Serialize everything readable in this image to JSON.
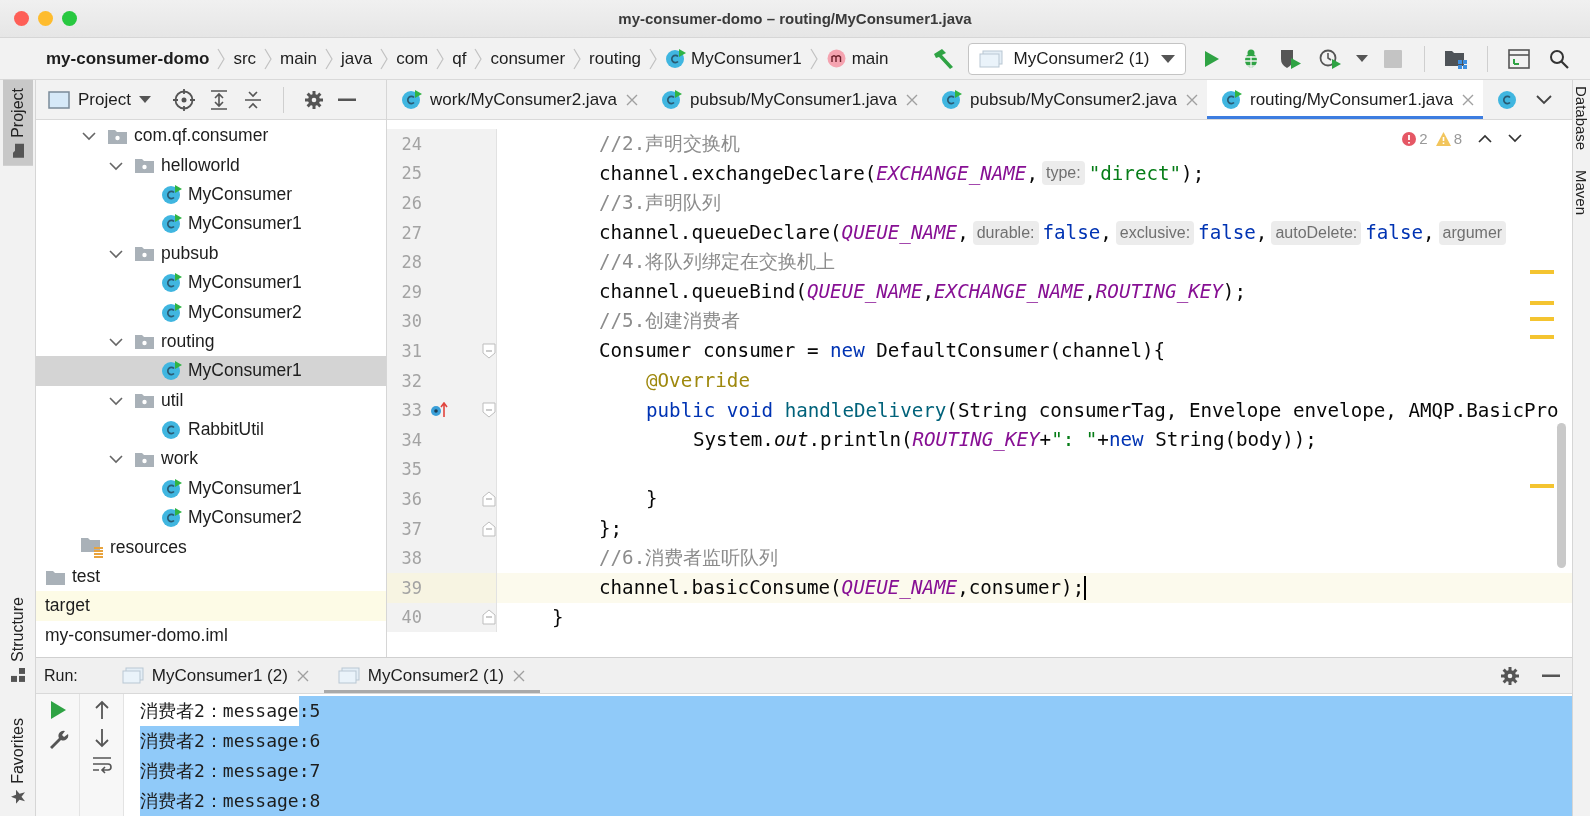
{
  "window": {
    "title": "my-consumer-domo – routing/MyConsumer1.java"
  },
  "breadcrumbs": [
    {
      "label": "my-consumer-domo",
      "kind": "project"
    },
    {
      "label": "src",
      "kind": "folder"
    },
    {
      "label": "main",
      "kind": "folder"
    },
    {
      "label": "java",
      "kind": "folder"
    },
    {
      "label": "com",
      "kind": "folder"
    },
    {
      "label": "qf",
      "kind": "folder"
    },
    {
      "label": "consumer",
      "kind": "folder"
    },
    {
      "label": "routing",
      "kind": "folder"
    },
    {
      "label": "MyConsumer1",
      "kind": "class"
    },
    {
      "label": "main",
      "kind": "method"
    }
  ],
  "run_config": {
    "label": "MyConsumer2 (1)"
  },
  "toolbar": [
    {
      "kind": "run",
      "disabled": false
    },
    {
      "kind": "debug",
      "disabled": false
    },
    {
      "kind": "coverage",
      "disabled": false
    },
    {
      "kind": "profile",
      "disabled": false
    },
    {
      "kind": "stop",
      "disabled": true
    },
    {
      "kind": "structure",
      "disabled": false
    },
    {
      "kind": "window",
      "disabled": false
    },
    {
      "kind": "search",
      "disabled": false
    }
  ],
  "left_strip": [
    {
      "label": "Project",
      "selected": true
    },
    {
      "label": "Structure",
      "selected": false
    },
    {
      "label": "Favorites",
      "selected": false
    }
  ],
  "right_strip": [
    {
      "label": "Database"
    },
    {
      "label": "Maven"
    }
  ],
  "project_panel": {
    "title": "Project",
    "tree": [
      {
        "label": "com.qf.consumer",
        "kind": "package",
        "expanded": true,
        "selected": false,
        "children": [
          {
            "label": "helloworld",
            "kind": "package",
            "expanded": true,
            "selected": false,
            "children": [
              {
                "label": "MyConsumer",
                "kind": "runnable",
                "selected": false
              },
              {
                "label": "MyConsumer1",
                "kind": "runnable",
                "selected": false
              }
            ]
          },
          {
            "label": "pubsub",
            "kind": "package",
            "expanded": true,
            "selected": false,
            "children": [
              {
                "label": "MyConsumer1",
                "kind": "runnable",
                "selected": false
              },
              {
                "label": "MyConsumer2",
                "kind": "runnable",
                "selected": false
              }
            ]
          },
          {
            "label": "routing",
            "kind": "package",
            "expanded": true,
            "selected": false,
            "children": [
              {
                "label": "MyConsumer1",
                "kind": "runnable",
                "selected": true
              }
            ]
          },
          {
            "label": "util",
            "kind": "package",
            "expanded": true,
            "selected": false,
            "children": [
              {
                "label": "RabbitUtil",
                "kind": "class",
                "selected": false
              }
            ]
          },
          {
            "label": "work",
            "kind": "package",
            "expanded": true,
            "selected": false,
            "children": [
              {
                "label": "MyConsumer1",
                "kind": "runnable",
                "selected": false
              },
              {
                "label": "MyConsumer2",
                "kind": "runnable",
                "selected": false
              }
            ]
          }
        ]
      },
      {
        "label": "resources",
        "kind": "resources",
        "selected": false
      },
      {
        "label": "test",
        "kind": "folder",
        "selected": false
      },
      {
        "label": "target",
        "kind": "excluded",
        "selected": false
      },
      {
        "label": "my-consumer-domo.iml",
        "kind": "file",
        "selected": false
      }
    ]
  },
  "editor": {
    "tabs": [
      {
        "label": "work/MyConsumer2.java",
        "selected": false
      },
      {
        "label": "pubsub/MyConsumer1.java",
        "selected": false
      },
      {
        "label": "pubsub/MyConsumer2.java",
        "selected": false
      },
      {
        "label": "routing/MyConsumer1.java",
        "selected": true
      }
    ],
    "errors": "2",
    "warnings": "8",
    "lines": [
      {
        "number": "24",
        "kind": "code",
        "current": false,
        "override": false,
        "foldable": false,
        "tokens": [
          {
            "kind": "comment",
            "text": "//2.声明交换机"
          }
        ]
      },
      {
        "number": "25",
        "kind": "code",
        "current": false,
        "override": false,
        "foldable": false,
        "tokens": [
          {
            "kind": "plain",
            "text": "channel.exchangeDeclare("
          },
          {
            "kind": "constant",
            "text": "EXCHANGE_NAME"
          },
          {
            "kind": "plain",
            "text": ","
          },
          {
            "kind": "hint",
            "text": "type:"
          },
          {
            "kind": "string",
            "text": "\"direct\""
          },
          {
            "kind": "plain",
            "text": ");"
          }
        ]
      },
      {
        "number": "26",
        "kind": "code",
        "current": false,
        "override": false,
        "foldable": false,
        "tokens": [
          {
            "kind": "comment",
            "text": "//3.声明队列"
          }
        ]
      },
      {
        "number": "27",
        "kind": "code",
        "current": false,
        "override": false,
        "foldable": false,
        "tokens": [
          {
            "kind": "plain",
            "text": "channel.queueDeclare("
          },
          {
            "kind": "constant",
            "text": "QUEUE_NAME"
          },
          {
            "kind": "plain",
            "text": ","
          },
          {
            "kind": "hint",
            "text": "durable:"
          },
          {
            "kind": "keyword",
            "text": "false"
          },
          {
            "kind": "plain",
            "text": ","
          },
          {
            "kind": "hint",
            "text": "exclusive:"
          },
          {
            "kind": "keyword",
            "text": "false"
          },
          {
            "kind": "plain",
            "text": ","
          },
          {
            "kind": "hint",
            "text": "autoDelete:"
          },
          {
            "kind": "keyword",
            "text": "false"
          },
          {
            "kind": "plain",
            "text": ","
          },
          {
            "kind": "hint",
            "text": "argumer"
          }
        ]
      },
      {
        "number": "28",
        "kind": "code",
        "current": false,
        "override": false,
        "foldable": false,
        "tokens": [
          {
            "kind": "comment",
            "text": "//4.将队列绑定在交换机上"
          }
        ]
      },
      {
        "number": "29",
        "kind": "code",
        "current": false,
        "override": false,
        "foldable": false,
        "tokens": [
          {
            "kind": "plain",
            "text": "channel.queueBind("
          },
          {
            "kind": "constant",
            "text": "QUEUE_NAME"
          },
          {
            "kind": "plain",
            "text": ","
          },
          {
            "kind": "constant",
            "text": "EXCHANGE_NAME"
          },
          {
            "kind": "plain",
            "text": ","
          },
          {
            "kind": "constant",
            "text": "ROUTING_KEY"
          },
          {
            "kind": "plain",
            "text": ");"
          }
        ]
      },
      {
        "number": "30",
        "kind": "code",
        "current": false,
        "override": false,
        "foldable": false,
        "tokens": [
          {
            "kind": "comment",
            "text": "//5.创建消费者"
          }
        ]
      },
      {
        "number": "31",
        "kind": "code",
        "current": false,
        "override": false,
        "foldable": true,
        "tokens": [
          {
            "kind": "plain",
            "text": "Consumer consumer = "
          },
          {
            "kind": "keyword",
            "text": "new"
          },
          {
            "kind": "plain",
            "text": " DefaultConsumer(channel){"
          }
        ],
        "children": [
          {
            "number": "32",
            "kind": "code",
            "current": false,
            "override": false,
            "foldable": false,
            "tokens": [
              {
                "kind": "annotation",
                "text": "@Override"
              }
            ]
          },
          {
            "number": "33",
            "kind": "code",
            "current": false,
            "override": true,
            "foldable": true,
            "tokens": [
              {
                "kind": "keyword",
                "text": "public void"
              },
              {
                "kind": "method",
                "text": " handleDelivery"
              },
              {
                "kind": "plain",
                "text": "(String consumerTag, Envelope envelope, AMQP.BasicPro"
              }
            ],
            "children": [
              {
                "number": "34",
                "kind": "code",
                "current": false,
                "override": false,
                "foldable": false,
                "tokens": [
                  {
                    "kind": "plain",
                    "text": "System."
                  },
                  {
                    "kind": "static",
                    "text": "out"
                  },
                  {
                    "kind": "plain",
                    "text": ".println("
                  },
                  {
                    "kind": "constant",
                    "text": "ROUTING_KEY"
                  },
                  {
                    "kind": "plain",
                    "text": "+"
                  },
                  {
                    "kind": "string",
                    "text": "\": \""
                  },
                  {
                    "kind": "plain",
                    "text": "+"
                  },
                  {
                    "kind": "keyword",
                    "text": "new"
                  },
                  {
                    "kind": "plain",
                    "text": " String(body));"
                  }
                ]
              },
              {
                "number": "35",
                "kind": "code",
                "current": false,
                "override": false,
                "foldable": false
              },
              {
                "number": "36",
                "kind": "closing",
                "current": false,
                "override": false,
                "foldable": true,
                "tokens": [
                  {
                    "kind": "plain",
                    "text": "}"
                  }
                ]
              }
            ]
          },
          {
            "number": "37",
            "kind": "closing",
            "current": false,
            "override": false,
            "foldable": true,
            "tokens": [
              {
                "kind": "plain",
                "text": "};"
              }
            ]
          }
        ]
      },
      {
        "number": "38",
        "kind": "code",
        "current": false,
        "override": false,
        "foldable": false,
        "tokens": [
          {
            "kind": "comment",
            "text": "//6.消费者监听队列"
          }
        ]
      },
      {
        "number": "39",
        "kind": "code",
        "current": true,
        "override": false,
        "foldable": false,
        "tokens": [
          {
            "kind": "plain",
            "text": "channel.basicConsume("
          },
          {
            "kind": "constant",
            "text": "QUEUE_NAME"
          },
          {
            "kind": "plain",
            "text": ",consumer);"
          }
        ]
      },
      {
        "number": "40",
        "kind": "closing",
        "current": false,
        "override": false,
        "foldable": true,
        "tokens": [
          {
            "kind": "plain",
            "text": "}"
          }
        ]
      }
    ]
  },
  "run_panel": {
    "title": "Run:",
    "tabs": [
      {
        "label": "MyConsumer1 (2)",
        "selected": false
      },
      {
        "label": "MyConsumer2 (1)",
        "selected": true
      }
    ],
    "lines": [
      {
        "segments": [
          {
            "text": "消费者2：message",
            "selected": false
          },
          {
            "text": ":5",
            "selected": true
          }
        ]
      },
      {
        "segments": [
          {
            "text": "消费者2：message:6",
            "selected": true
          }
        ]
      },
      {
        "segments": [
          {
            "text": "消费者2：message:7",
            "selected": true
          }
        ]
      },
      {
        "segments": [
          {
            "text": "消费者2：message:8",
            "selected": true
          }
        ]
      }
    ]
  }
}
